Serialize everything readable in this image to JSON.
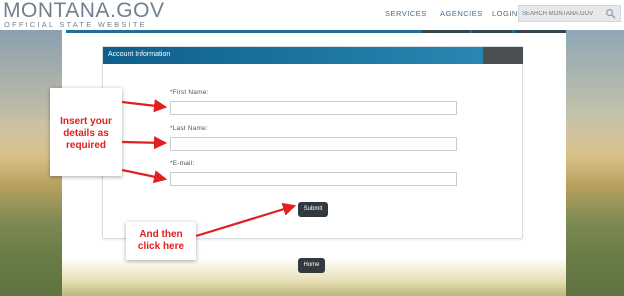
{
  "header": {
    "logo_main": "MONTANA.GOV",
    "logo_sub": "OFFICIAL STATE WEBSITE",
    "nav": [
      "SERVICES",
      "AGENCIES",
      "LOGIN"
    ],
    "search_placeholder": "SEARCH MONTANA.GOV",
    "search_icon": "search-icon"
  },
  "card": {
    "title": "Account Information",
    "fields": [
      {
        "label": "*First Name:",
        "value": ""
      },
      {
        "label": "*Last Name:",
        "value": ""
      },
      {
        "label": "*E-mail:",
        "value": ""
      }
    ],
    "submit_label": "Submit"
  },
  "home_label": "Home",
  "annotations": {
    "insert_details": [
      "Insert your",
      "details as",
      "required"
    ],
    "click_here": [
      "And then",
      "click here"
    ]
  },
  "colors": {
    "header_blue": "#0e5f8c",
    "annotation_red": "#e02020",
    "button_dark": "#333a3f"
  }
}
